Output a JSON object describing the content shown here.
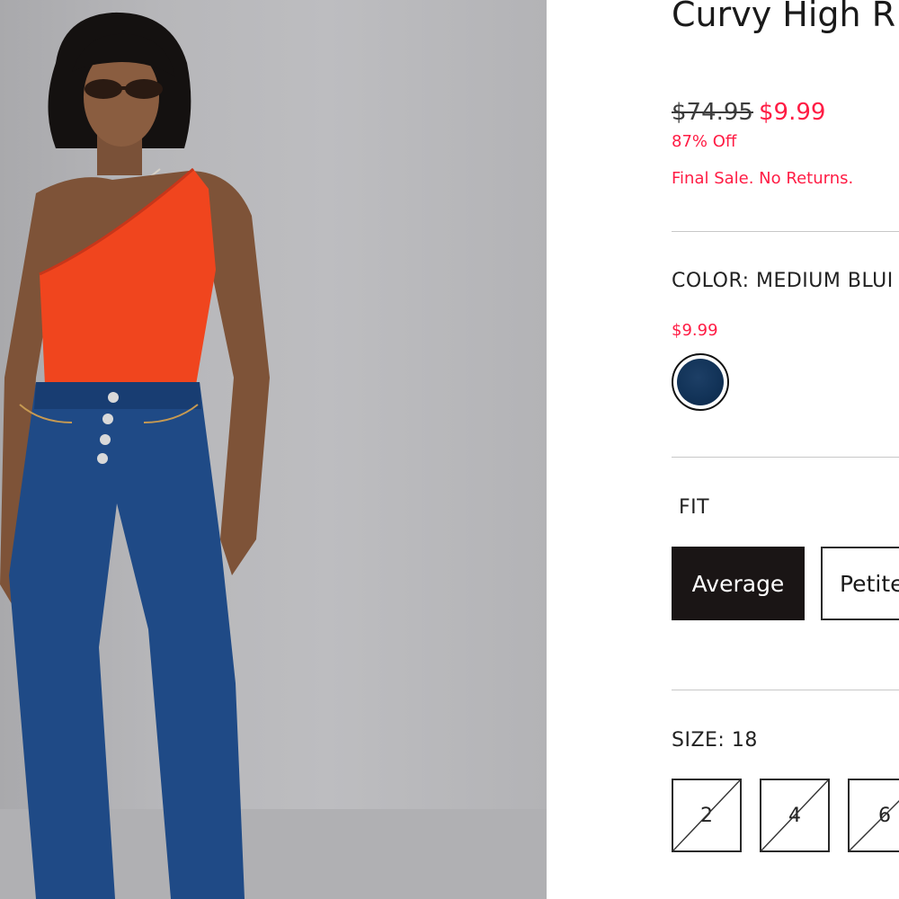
{
  "product": {
    "title": "Curvy High R",
    "original_price": "$74.95",
    "sale_price": "$9.99",
    "discount": "87% Off",
    "sale_note": "Final Sale. No Returns."
  },
  "color": {
    "label": "COLOR: MEDIUM BLUI",
    "price": "$9.99",
    "swatch_color": "#123358"
  },
  "fit": {
    "label": "FIT",
    "options": [
      {
        "label": "Average",
        "selected": true
      },
      {
        "label": "Petite",
        "selected": false
      }
    ]
  },
  "size": {
    "label": "SIZE: 18",
    "options": [
      {
        "label": "2",
        "available": false
      },
      {
        "label": "4",
        "available": false
      },
      {
        "label": "6",
        "available": false
      }
    ]
  },
  "colors": {
    "sale_red": "#ff1c44",
    "selected_fill": "#1a1515"
  }
}
